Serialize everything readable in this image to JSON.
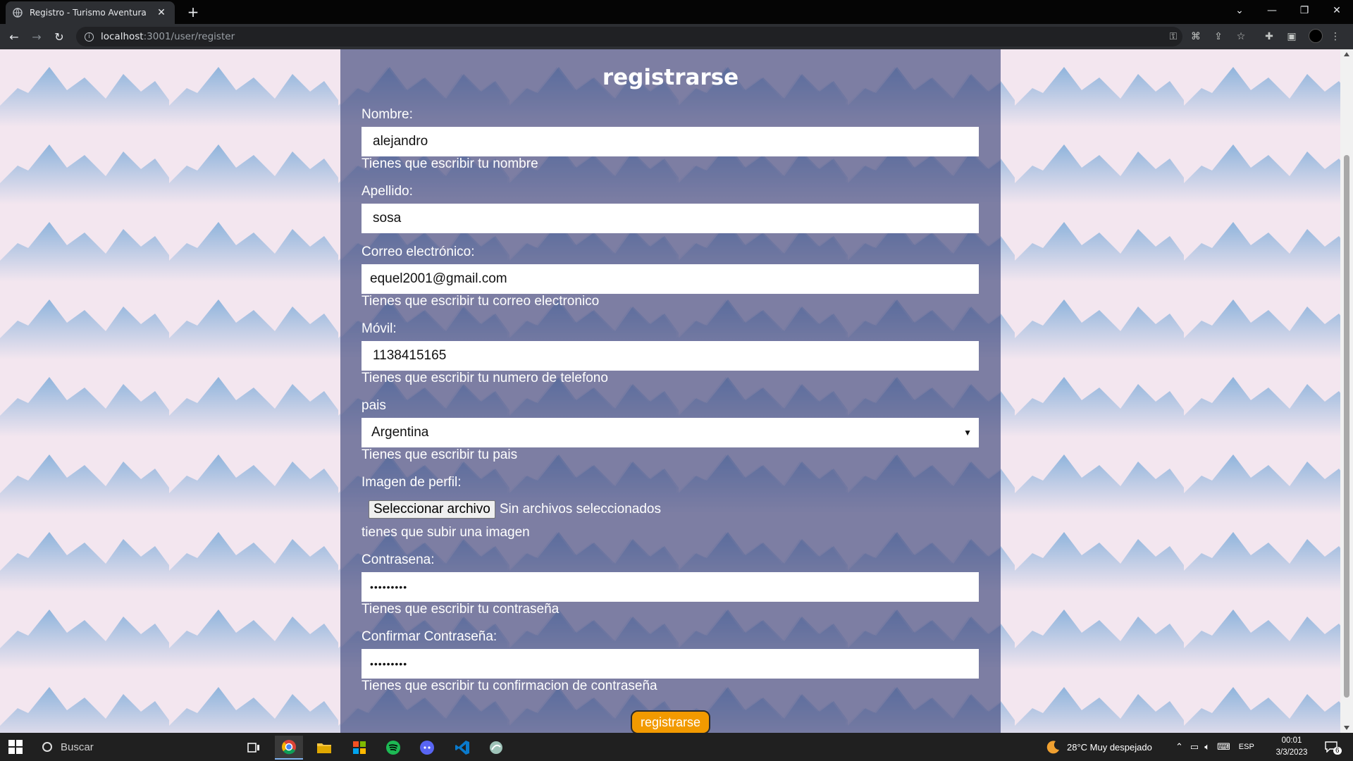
{
  "browser": {
    "tab_title": "Registro - Turismo Aventura",
    "url_host": "localhost",
    "url_rest": ":3001/user/register"
  },
  "form": {
    "title": "registrarse",
    "nombre": {
      "label": "Nombre:",
      "value": "alejandro",
      "error": "Tienes que escribir tu nombre"
    },
    "apellido": {
      "label": "Apellido:",
      "value": "sosa"
    },
    "correo": {
      "label": "Correo electrónico:",
      "value": "equel2001@gmail.com",
      "error": "Tienes que escribir tu correo electronico"
    },
    "movil": {
      "label": "Móvil:",
      "value": "1138415165",
      "error": "Tienes que escribir tu numero de telefono"
    },
    "pais": {
      "label": "pais",
      "value": "Argentina",
      "error": "Tienes que escribir tu pais"
    },
    "imagen": {
      "label": "Imagen de perfil:",
      "button": "Seleccionar archivo",
      "status": "Sin archivos seleccionados",
      "error": "tienes que subir una imagen"
    },
    "contrasena": {
      "label": "Contrasena:",
      "value": "•••••••••",
      "error": "Tienes que escribir tu contraseña"
    },
    "confirmar": {
      "label": "Confirmar Contraseña:",
      "value": "•••••••••",
      "error": "Tienes que escribir tu confirmacion de contraseña"
    },
    "submit_label": "registrarse"
  },
  "taskbar": {
    "search_placeholder": "Buscar",
    "weather": "28°C  Muy despejado",
    "language": "ESP",
    "time": "00:01",
    "date": "3/3/2023",
    "notifications": "6"
  },
  "colors": {
    "panel": "#40487c",
    "submit": "#f29a00",
    "page_bg": "#f3e6ef"
  }
}
